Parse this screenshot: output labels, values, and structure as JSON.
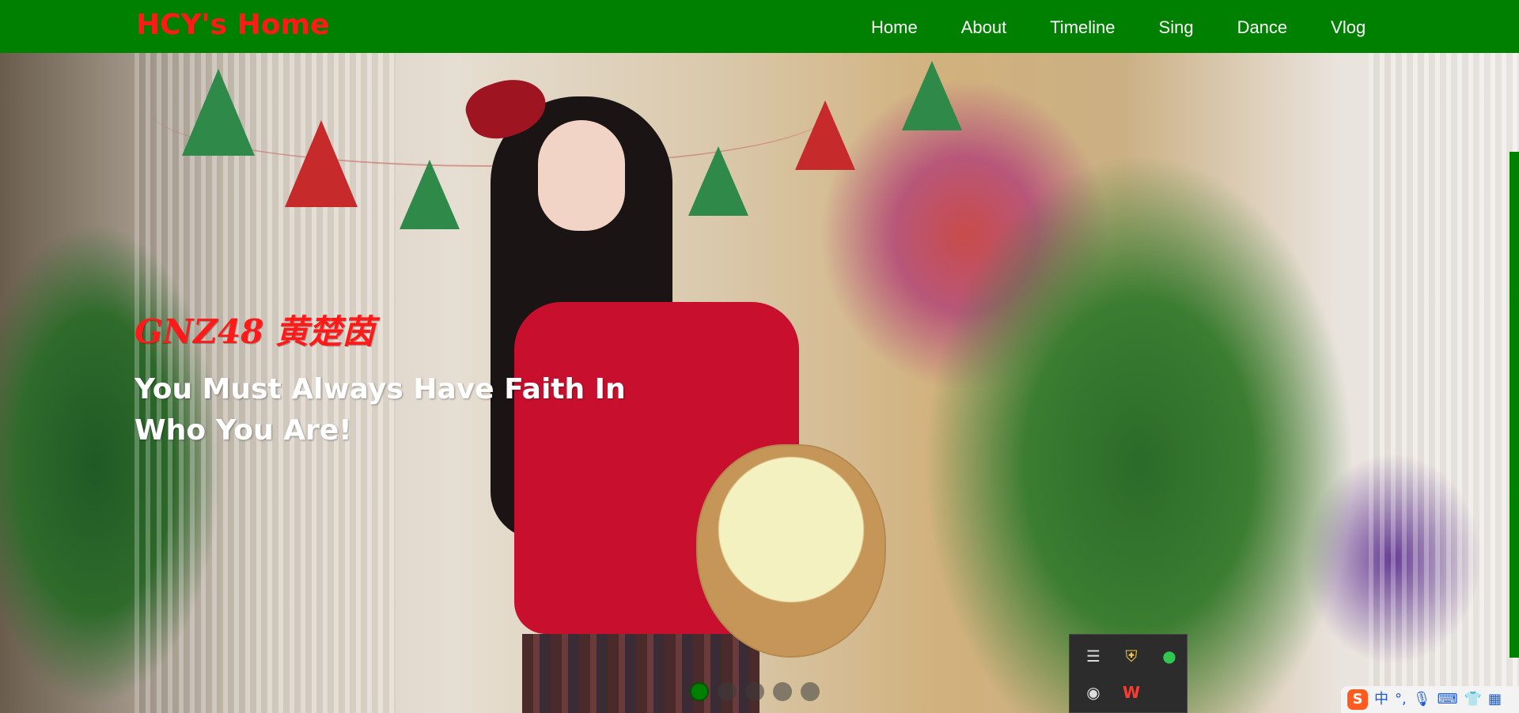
{
  "brand": "HCY's Home",
  "nav": {
    "items": [
      "Home",
      "About",
      "Timeline",
      "Sing",
      "Dance",
      "Vlog"
    ]
  },
  "hero": {
    "title": "GNZ48 黄楚茵",
    "subtitle": "You Must Always Have Faith In Who You Are!"
  },
  "carousel": {
    "total": 5,
    "active_index": 1
  },
  "tray": {
    "icons": [
      "playlist-icon",
      "shield-warning-icon",
      "wechat-icon",
      "discord-icon",
      "wps-icon"
    ]
  },
  "ime": {
    "icons": [
      "sogou-ime-icon",
      "chinese-mode-icon",
      "punctuation-icon",
      "microphone-icon",
      "keyboard-icon",
      "skin-icon",
      "apps-icon"
    ],
    "chinese_label": "中",
    "punctuation_label": "°,"
  },
  "colors": {
    "nav_bg": "#008000",
    "brand": "#ff1a1a",
    "hero_title": "#ff1a1a",
    "hero_subtitle": "#ffffff",
    "active_dot": "#008000"
  }
}
